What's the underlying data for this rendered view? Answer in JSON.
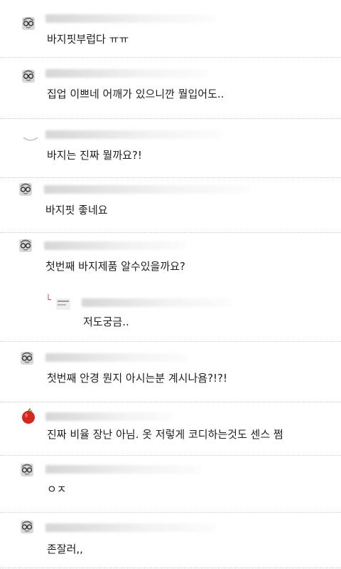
{
  "comments": [
    {
      "text": "바지핏부럽다 ㅠㅠ",
      "avatar": "glasses-man-icon"
    },
    {
      "text": "집업 이쁘네 어깨가 있으니깐 뭘입어도..",
      "avatar": "glasses-man-icon"
    },
    {
      "text": "바지는 진짜 뭘까요?!",
      "avatar": "default-profile-icon"
    },
    {
      "text": "바지핏 좋네요",
      "avatar": "glasses-man-icon"
    },
    {
      "text": "첫번째 바지제품 알수있을까요?",
      "avatar": "glasses-man-icon"
    },
    {
      "text": "저도궁금..",
      "avatar": "reply-icon",
      "is_reply": true
    },
    {
      "text": "첫번째 안경 뭔지 아시는분 계시나욤?!?!",
      "avatar": "glasses-man-icon"
    },
    {
      "text": "진짜 비율 장난 아님. 옷 저렇게 코디하는것도 센스 쩜",
      "avatar": "apple-icon"
    },
    {
      "text": "ㅇㅈ",
      "avatar": "glasses-man-icon"
    },
    {
      "text": "존잘러,,",
      "avatar": "glasses-man-icon"
    }
  ],
  "colors": {
    "divider": "#cfcfcf",
    "text": "#1e1e1e",
    "apple": "#d7261e",
    "reply_mark": "#d9534f"
  }
}
